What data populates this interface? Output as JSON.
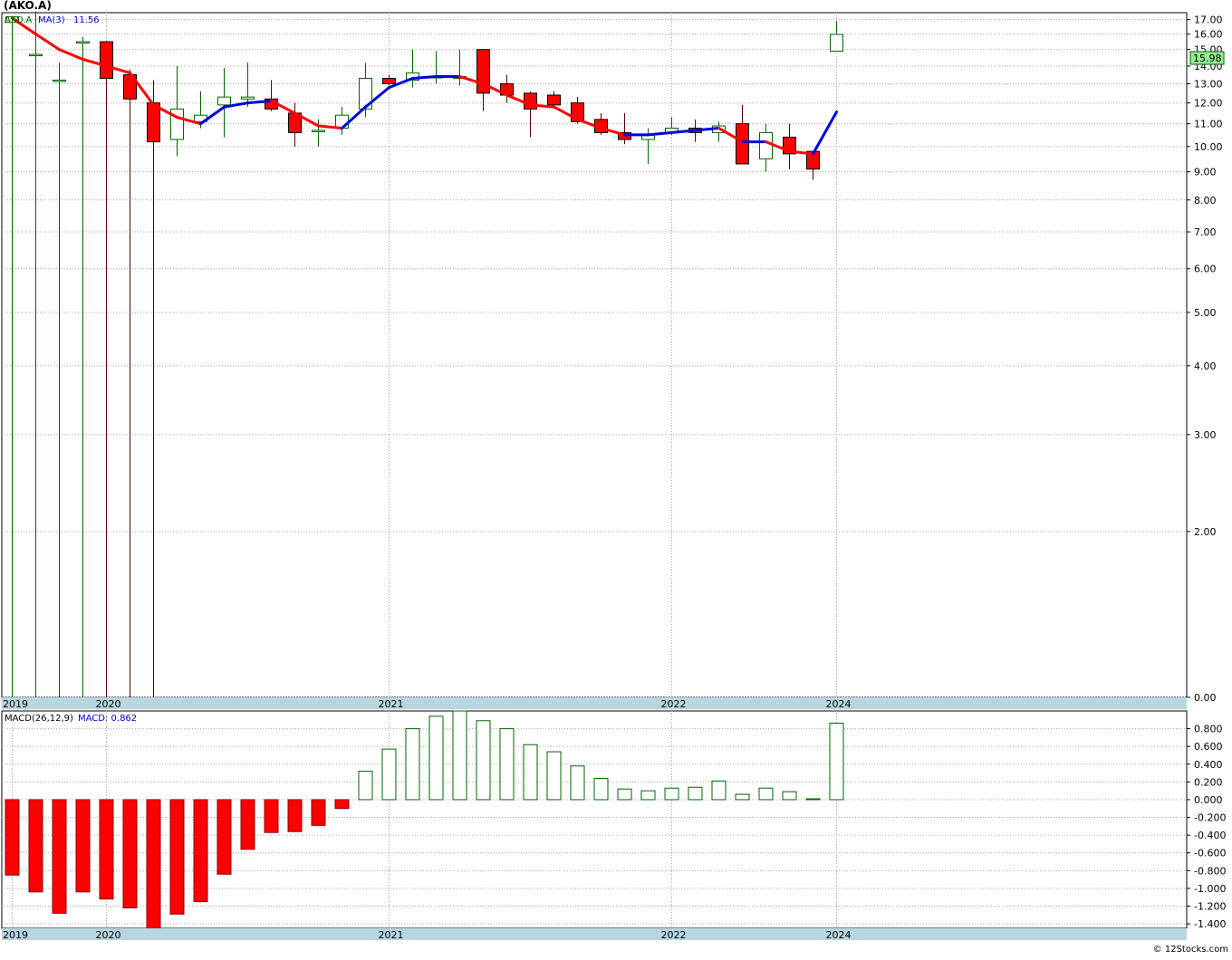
{
  "title": "(AKO.A)",
  "watermark": "© 12Stocks.com",
  "colors": {
    "up": "#006400",
    "down": "#ff0000",
    "ma_down": "#ff0000",
    "ma_up": "#0000dd",
    "axis_band": "#b7d6e0",
    "price_tag_bg": "#90ee90",
    "grid": "#aaaaaa"
  },
  "price_panel": {
    "legend": {
      "symbol": "AKO.A",
      "ma_label": "MA(3)",
      "ma_value": "11.56"
    },
    "last_price_tag": "15.98",
    "y_ticks": [
      "17.00",
      "16.00",
      "15.00",
      "14.00",
      "13.00",
      "12.00",
      "11.00",
      "10.00",
      "9.00",
      "8.00",
      "7.00",
      "6.00",
      "5.00",
      "4.00",
      "3.00",
      "2.00",
      "0.00"
    ],
    "x_labels": [
      "2019",
      "2020",
      "2021",
      "2022",
      "2024"
    ]
  },
  "macd_panel": {
    "legend": {
      "label": "MACD(26,12,9)",
      "value_label": "MACD: 0.862"
    },
    "y_ticks": [
      "0.800",
      "0.600",
      "0.400",
      "0.200",
      "0.000",
      "-0.200",
      "-0.400",
      "-0.600",
      "-0.800",
      "-1.000",
      "-1.200",
      "-1.400"
    ],
    "x_labels": [
      "2019",
      "2020",
      "2021",
      "2022",
      "2024"
    ]
  },
  "chart_data": [
    {
      "type": "candlestick",
      "title": "(AKO.A)",
      "scale": "log",
      "ylim": [
        1.0,
        17.5
      ],
      "x_labels": [
        "2019",
        "2020",
        "2021",
        "2022",
        "2024"
      ],
      "candles": [
        {
          "o": 16.8,
          "h": 17.2,
          "l": 1.0,
          "c": 17.2
        },
        {
          "o": 14.7,
          "h": 17.6,
          "l": 1.0,
          "c": 14.7
        },
        {
          "o": 13.2,
          "h": 14.2,
          "l": 1.0,
          "c": 13.2
        },
        {
          "o": 15.5,
          "h": 15.8,
          "l": 1.0,
          "c": 15.5
        },
        {
          "o": 15.5,
          "h": 15.5,
          "l": 1.0,
          "c": 13.3
        },
        {
          "o": 13.5,
          "h": 13.8,
          "l": 1.0,
          "c": 12.2
        },
        {
          "o": 12.0,
          "h": 13.2,
          "l": 1.0,
          "c": 10.2
        },
        {
          "o": 10.3,
          "h": 14.0,
          "l": 9.6,
          "c": 11.7
        },
        {
          "o": 11.1,
          "h": 12.6,
          "l": 10.8,
          "c": 11.4
        },
        {
          "o": 11.9,
          "h": 13.9,
          "l": 10.4,
          "c": 12.3
        },
        {
          "o": 12.2,
          "h": 14.2,
          "l": 11.8,
          "c": 12.3
        },
        {
          "o": 12.2,
          "h": 13.2,
          "l": 11.6,
          "c": 11.7
        },
        {
          "o": 11.5,
          "h": 12.0,
          "l": 10.0,
          "c": 10.6
        },
        {
          "o": 10.7,
          "h": 11.2,
          "l": 10.0,
          "c": 10.7
        },
        {
          "o": 10.8,
          "h": 11.8,
          "l": 10.5,
          "c": 11.4
        },
        {
          "o": 11.7,
          "h": 14.2,
          "l": 11.3,
          "c": 13.3
        },
        {
          "o": 13.3,
          "h": 13.5,
          "l": 12.9,
          "c": 13.0
        },
        {
          "o": 13.2,
          "h": 15.0,
          "l": 12.8,
          "c": 13.6
        },
        {
          "o": 13.4,
          "h": 14.9,
          "l": 13.0,
          "c": 13.4
        },
        {
          "o": 13.3,
          "h": 15.0,
          "l": 12.9,
          "c": 13.4
        },
        {
          "o": 15.0,
          "h": 15.0,
          "l": 11.6,
          "c": 12.5
        },
        {
          "o": 13.0,
          "h": 13.5,
          "l": 12.0,
          "c": 12.4
        },
        {
          "o": 12.5,
          "h": 12.6,
          "l": 10.4,
          "c": 11.7
        },
        {
          "o": 12.4,
          "h": 12.6,
          "l": 11.8,
          "c": 11.9
        },
        {
          "o": 12.0,
          "h": 12.3,
          "l": 11.0,
          "c": 11.1
        },
        {
          "o": 11.2,
          "h": 11.5,
          "l": 10.5,
          "c": 10.6
        },
        {
          "o": 10.6,
          "h": 11.5,
          "l": 10.1,
          "c": 10.3
        },
        {
          "o": 10.3,
          "h": 10.8,
          "l": 9.3,
          "c": 10.5
        },
        {
          "o": 10.6,
          "h": 11.3,
          "l": 10.5,
          "c": 10.8
        },
        {
          "o": 10.8,
          "h": 11.2,
          "l": 10.2,
          "c": 10.6
        },
        {
          "o": 10.6,
          "h": 11.1,
          "l": 10.2,
          "c": 10.9
        },
        {
          "o": 11.0,
          "h": 11.9,
          "l": 9.3,
          "c": 9.3
        },
        {
          "o": 9.5,
          "h": 11.0,
          "l": 9.0,
          "c": 10.6
        },
        {
          "o": 10.4,
          "h": 11.0,
          "l": 9.1,
          "c": 9.7
        },
        {
          "o": 9.8,
          "h": 9.8,
          "l": 8.7,
          "c": 9.1
        },
        {
          "o": 14.9,
          "h": 16.9,
          "l": 14.9,
          "c": 15.98
        }
      ],
      "ma3": [
        17.1,
        16.0,
        15.0,
        14.4,
        14.0,
        13.6,
        11.9,
        11.3,
        11.0,
        11.8,
        12.0,
        12.1,
        11.5,
        10.9,
        10.8,
        11.8,
        12.8,
        13.3,
        13.4,
        13.4,
        13.0,
        12.4,
        11.9,
        11.8,
        11.2,
        10.8,
        10.5,
        10.5,
        10.6,
        10.7,
        10.8,
        10.2,
        10.2,
        9.8,
        9.7,
        11.56
      ]
    },
    {
      "type": "bar",
      "title": "MACD(26,12,9)",
      "ylim": [
        -1.45,
        1.0
      ],
      "x_labels": [
        "2019",
        "2020",
        "2021",
        "2022",
        "2024"
      ],
      "values": [
        -0.85,
        -1.04,
        -1.28,
        -1.04,
        -1.12,
        -1.22,
        -1.45,
        -1.29,
        -1.15,
        -0.84,
        -0.56,
        -0.37,
        -0.36,
        -0.29,
        -0.1,
        0.32,
        0.57,
        0.8,
        0.94,
        1.0,
        0.89,
        0.8,
        0.62,
        0.54,
        0.38,
        0.24,
        0.12,
        0.1,
        0.13,
        0.14,
        0.21,
        0.06,
        0.13,
        0.09,
        0.01,
        0.862
      ]
    }
  ]
}
